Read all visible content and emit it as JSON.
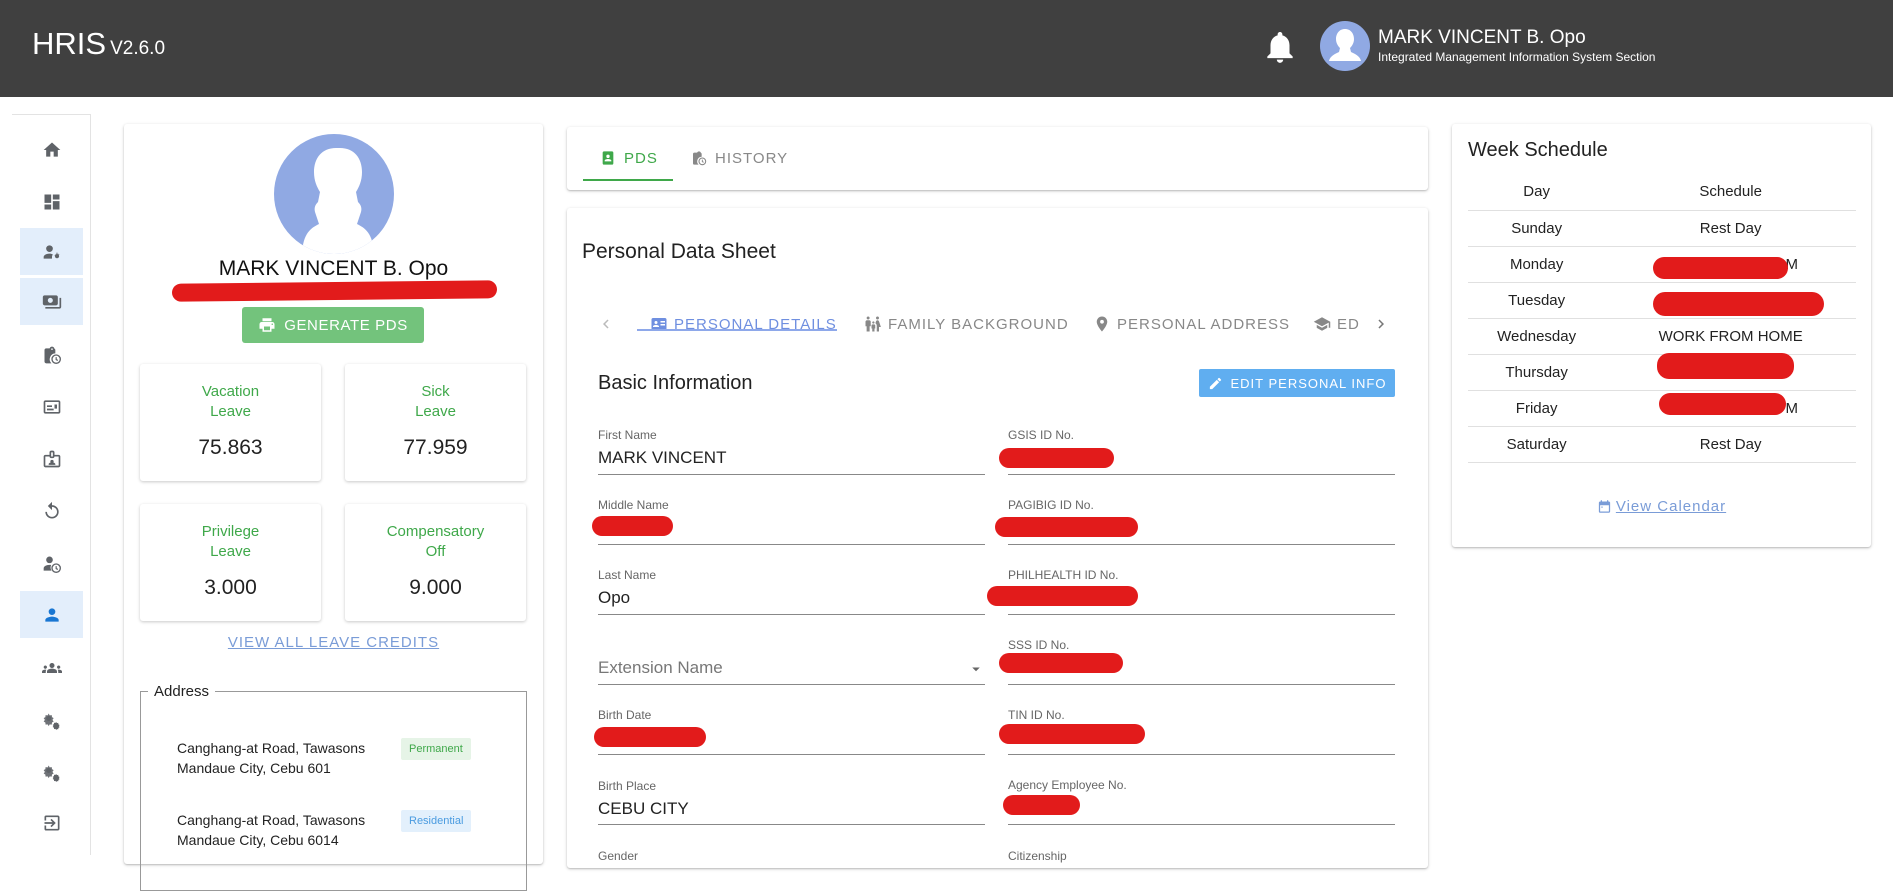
{
  "header": {
    "app_name": "HRIS",
    "version": "V2.6.0",
    "user_name": "MARK VINCENT B. Opo",
    "user_section": "Integrated Management Information System Section",
    "icons": [
      "bell-icon",
      "avatar"
    ]
  },
  "sidebar": {
    "items": [
      {
        "icon": "home-icon"
      },
      {
        "icon": "dashboard-icon"
      },
      {
        "icon": "user-settings-icon"
      },
      {
        "icon": "payroll-icon"
      },
      {
        "icon": "clipboard-clock-icon"
      },
      {
        "icon": "id-card-icon"
      },
      {
        "icon": "badge-icon"
      },
      {
        "icon": "refresh-icon"
      },
      {
        "icon": "user-clock-icon"
      },
      {
        "icon": "person-icon"
      },
      {
        "icon": "group-icon"
      },
      {
        "icon": "gears-icon"
      },
      {
        "icon": "gears-icon"
      },
      {
        "icon": "logout-icon"
      }
    ]
  },
  "profile": {
    "name": "MARK VINCENT B. Opo",
    "generate_label": "GENERATE PDS",
    "leaves": [
      {
        "label_line1": "Vacation",
        "label_line2": "Leave",
        "value": "75.863"
      },
      {
        "label_line1": "Sick",
        "label_line2": "Leave",
        "value": "77.959"
      },
      {
        "label_line1": "Privilege",
        "label_line2": "Leave",
        "value": "3.000"
      },
      {
        "label_line1": "Compensatory",
        "label_line2": "Off",
        "value": "9.000"
      }
    ],
    "view_all_label": "VIEW ALL LEAVE CREDITS",
    "address_legend": "Address",
    "addresses": [
      {
        "line1": "Canghang-at Road, Tawasons",
        "line2": "Mandaue City, Cebu 601",
        "type": "Permanent"
      },
      {
        "line1": "Canghang-at Road, Tawasons",
        "line2": "Mandaue City, Cebu 6014",
        "type": "Residential"
      }
    ]
  },
  "main_tabs": [
    {
      "label": "PDS",
      "active": true
    },
    {
      "label": "HISTORY",
      "active": false
    }
  ],
  "pds": {
    "title": "Personal Data Sheet",
    "sub_tabs": [
      {
        "label": "PERSONAL DETAILS",
        "active": true
      },
      {
        "label": "FAMILY BACKGROUND",
        "active": false
      },
      {
        "label": "PERSONAL ADDRESS",
        "active": false
      },
      {
        "label": "ED",
        "active": false
      }
    ],
    "basic_info_title": "Basic Information",
    "edit_label": "EDIT PERSONAL INFO",
    "fields_left": [
      {
        "label": "First Name",
        "value": "MARK VINCENT"
      },
      {
        "label": "Middle Name",
        "value": ""
      },
      {
        "label": "Last Name",
        "value": "Opo"
      },
      {
        "label": "",
        "value": "",
        "placeholder": "Extension Name"
      },
      {
        "label": "Birth Date",
        "value": ""
      },
      {
        "label": "Birth Place",
        "value": "CEBU CITY"
      },
      {
        "label": "Gender",
        "value": ""
      }
    ],
    "fields_right": [
      {
        "label": "GSIS ID No.",
        "value": ""
      },
      {
        "label": "PAGIBIG ID No.",
        "value": ""
      },
      {
        "label": "PHILHEALTH ID No.",
        "value": ""
      },
      {
        "label": "SSS ID No.",
        "value": ""
      },
      {
        "label": "TIN ID No.",
        "value": ""
      },
      {
        "label": "Agency Employee No.",
        "value": ""
      },
      {
        "label": "Citizenship",
        "value": ""
      }
    ]
  },
  "schedule": {
    "title": "Week Schedule",
    "headers": [
      "Day",
      "Schedule"
    ],
    "rows": [
      [
        "Sunday",
        "Rest Day"
      ],
      [
        "Monday",
        "M"
      ],
      [
        "Tuesday",
        ""
      ],
      [
        "Wednesday",
        "WORK FROM HOME"
      ],
      [
        "Thursday",
        ""
      ],
      [
        "Friday",
        "M"
      ],
      [
        "Saturday",
        "Rest Day"
      ]
    ],
    "calendar_label": "View Calendar"
  },
  "colors": {
    "topbar": "#404040",
    "green": "#3fa84a",
    "blue_link": "#7a9cd7",
    "redaction": "#e21b1b",
    "edit_button": "#60aef0"
  }
}
